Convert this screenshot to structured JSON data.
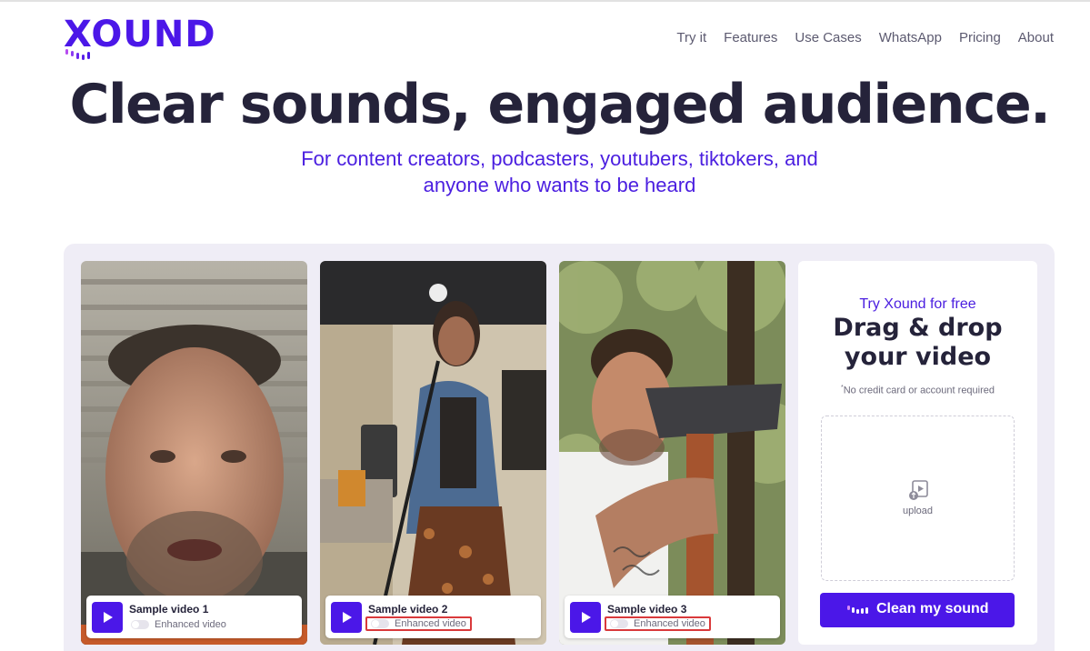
{
  "brand": {
    "logo_text": "XOUND",
    "accent": "#4b17e8",
    "sub_accent": "#b74cf0"
  },
  "nav": {
    "items": [
      "Try it",
      "Features",
      "Use Cases",
      "WhatsApp",
      "Pricing",
      "About"
    ]
  },
  "hero": {
    "title": "Clear sounds, engaged audience.",
    "subtitle_line1": "For content creators, podcasters, youtubers, tiktokers, and",
    "subtitle_line2": "anyone who wants to be heard"
  },
  "samples": [
    {
      "title": "Sample video 1",
      "toggle_label": "Enhanced video",
      "enhanced": false,
      "highlighted": false
    },
    {
      "title": "Sample video 2",
      "toggle_label": "Enhanced video",
      "enhanced": false,
      "highlighted": true
    },
    {
      "title": "Sample video 3",
      "toggle_label": "Enhanced video",
      "enhanced": false,
      "highlighted": true
    }
  ],
  "upload": {
    "try_label": "Try Xound for free",
    "title_line1": "Drag & drop",
    "title_line2": "your video",
    "note_mark": "*",
    "note": "No credit card or account required",
    "dropzone_label": "upload",
    "cta_label": "Clean my sound",
    "icons": {
      "upload": "video-upload-icon",
      "cta": "sound-bars-icon",
      "play": "play-icon"
    }
  },
  "colors": {
    "panel_bg": "#efedf6",
    "highlight_border": "#d9393b",
    "title_text": "#25233a",
    "subtitle_text": "#4b1fe0"
  }
}
